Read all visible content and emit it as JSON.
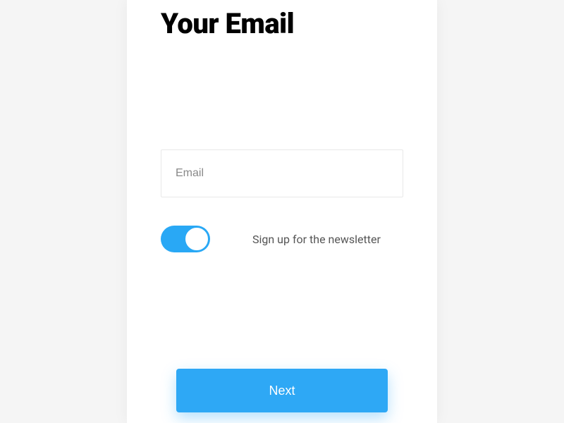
{
  "page": {
    "title": "Your Email"
  },
  "form": {
    "email_placeholder": "Email",
    "email_value": "",
    "newsletter_label": "Sign up for the newsletter",
    "newsletter_enabled": true
  },
  "actions": {
    "next_label": "Next"
  },
  "colors": {
    "accent": "#2ea8f5"
  }
}
